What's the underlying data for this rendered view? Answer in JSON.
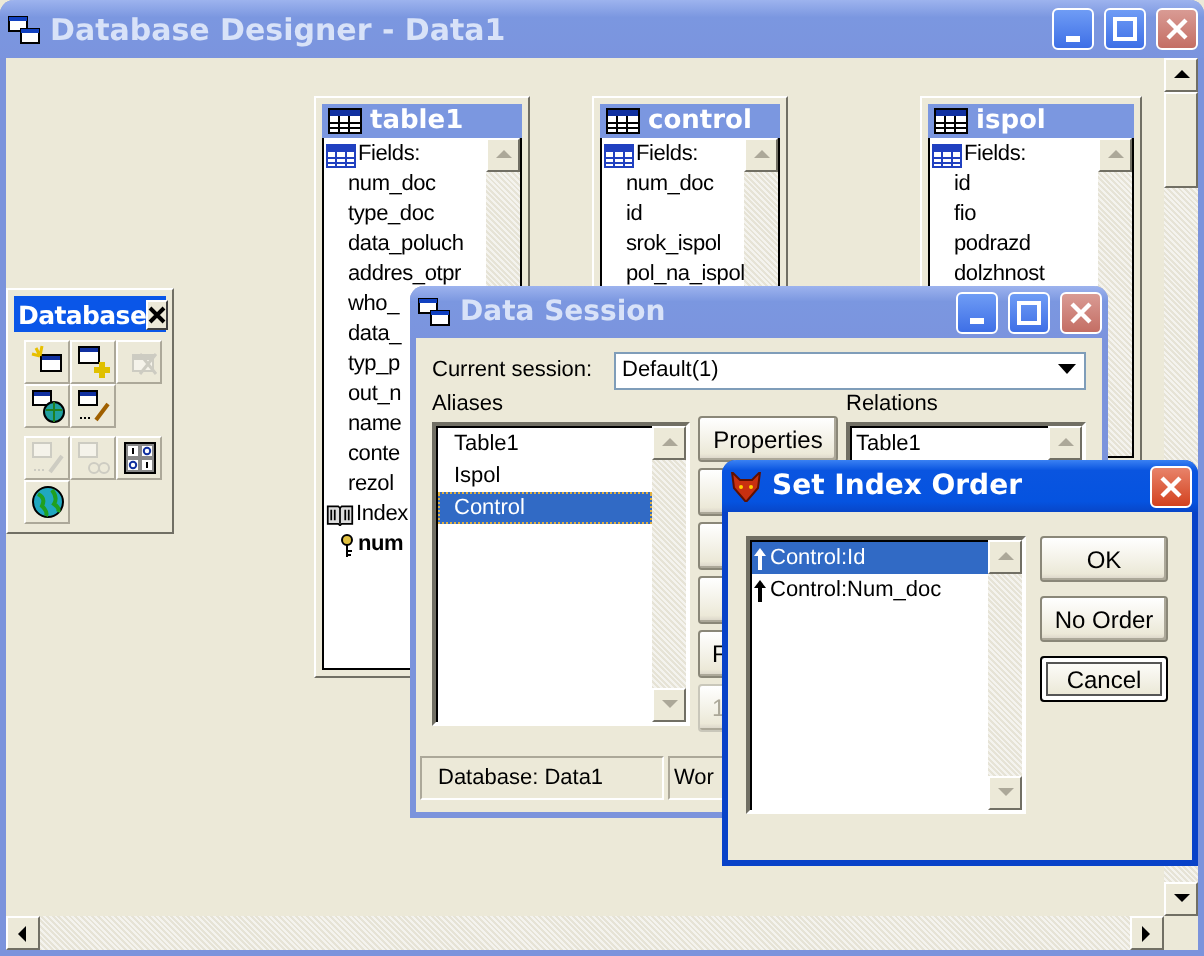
{
  "main_window": {
    "title": "Database Designer - Data1",
    "active": false
  },
  "tables": [
    {
      "title": "table1",
      "fields_label": "Fields:",
      "fields": [
        "num_doc",
        "type_doc",
        "data_poluch",
        "addres_otpr",
        "who_",
        "data_",
        "typ_p",
        "out_n",
        "name",
        "conte",
        "rezol"
      ],
      "index_label": "Index",
      "indexes": [
        "num"
      ]
    },
    {
      "title": "control",
      "fields_label": "Fields:",
      "fields": [
        "num_doc",
        "id",
        "srok_ispol",
        "pol_na_ispol"
      ]
    },
    {
      "title": "ispol",
      "fields_label": "Fields:",
      "fields": [
        "id",
        "fio",
        "podrazd",
        "dolzhnost"
      ]
    }
  ],
  "toolbar": {
    "title": "Database",
    "groups": [
      [
        {
          "kind": "new",
          "disabled": false
        },
        {
          "kind": "add",
          "disabled": false
        },
        {
          "kind": "remove",
          "disabled": true
        },
        {
          "kind": "link",
          "disabled": false
        },
        {
          "kind": "modify",
          "disabled": false
        }
      ],
      [
        {
          "kind": "edit",
          "disabled": true
        },
        {
          "kind": "browse",
          "disabled": true
        },
        {
          "kind": "grid",
          "disabled": false
        },
        {
          "kind": "globe",
          "disabled": false
        }
      ]
    ]
  },
  "data_session": {
    "title": "Data Session",
    "active": false,
    "current_session_label": "Current session:",
    "current_session": "Default(1)",
    "aliases_label": "Aliases",
    "aliases": [
      {
        "name": "Table1",
        "selected": false
      },
      {
        "name": "Ispol",
        "selected": false
      },
      {
        "name": "Control",
        "selected": true
      }
    ],
    "buttons": [
      {
        "label": "Properties",
        "disabled": false
      },
      {
        "disabled": false
      },
      {
        "disabled": false
      },
      {
        "disabled": false
      },
      {
        "label": "F",
        "disabled": false
      },
      {
        "label": "1",
        "disabled": true
      }
    ],
    "relations_label": "Relations",
    "relations": [
      "Table1"
    ],
    "status": [
      "Database: Data1",
      "Wor"
    ]
  },
  "index_dialog": {
    "title": "Set Index Order",
    "active": true,
    "items": [
      {
        "label": "Control:Id",
        "selected": true
      },
      {
        "label": "Control:Num_doc",
        "selected": false
      }
    ],
    "buttons": [
      {
        "label": "OK",
        "default": false
      },
      {
        "label": "No Order",
        "default": false
      },
      {
        "label": "Cancel",
        "default": true
      }
    ]
  }
}
